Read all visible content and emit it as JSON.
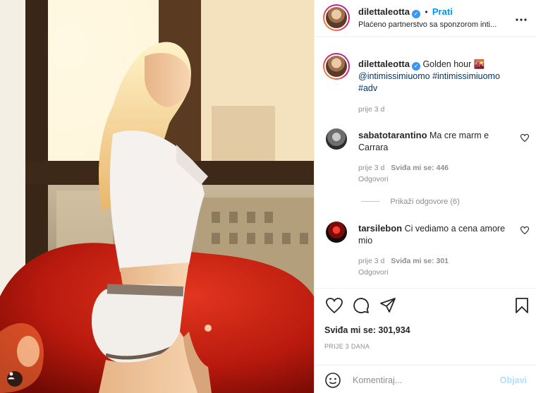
{
  "post": {
    "author": "dilettaleotta",
    "follow_label": "Prati",
    "separator": "•",
    "paid_partnership": "Plaćeno partnerstvo sa sponzorom inti...",
    "more_label": "•••",
    "caption": {
      "username": "dilettaleotta",
      "text": "Golden hour 🌇",
      "mentions": "@intimissimiuomo #intimissimiuomo",
      "tag": "#adv",
      "time": "prije 3 d"
    },
    "comments": [
      {
        "username": "sabatotarantino",
        "text": "Ma cre marm e Carrara",
        "time": "prije 3 d",
        "likes": "Sviđa mi se: 446",
        "reply": "Odgovori",
        "view_replies": "Prikaži odgovore (6)"
      },
      {
        "username": "tarsilebon",
        "text": "Ci vediamo a cena amore mio",
        "time": "prije 3 d",
        "likes": "Sviđa mi se: 301",
        "reply": "Odgovori"
      }
    ],
    "likes_label": "Sviđa mi se: 301,934",
    "date": "PRIJE 3 DANA",
    "comment_placeholder": "Komentiraj...",
    "post_button": "Objavi"
  },
  "icons": {
    "like": "heart-icon",
    "comment": "comment-icon",
    "share": "send-icon",
    "save": "bookmark-icon",
    "emoji": "emoji-icon",
    "verified": "verified-badge-icon",
    "tag": "user-tag-icon"
  },
  "colors": {
    "link_blue": "#0095f6",
    "verified_blue": "#3897f0",
    "muted": "#8e8e8e",
    "text": "#262626",
    "post_disabled": "#b2dffc"
  }
}
